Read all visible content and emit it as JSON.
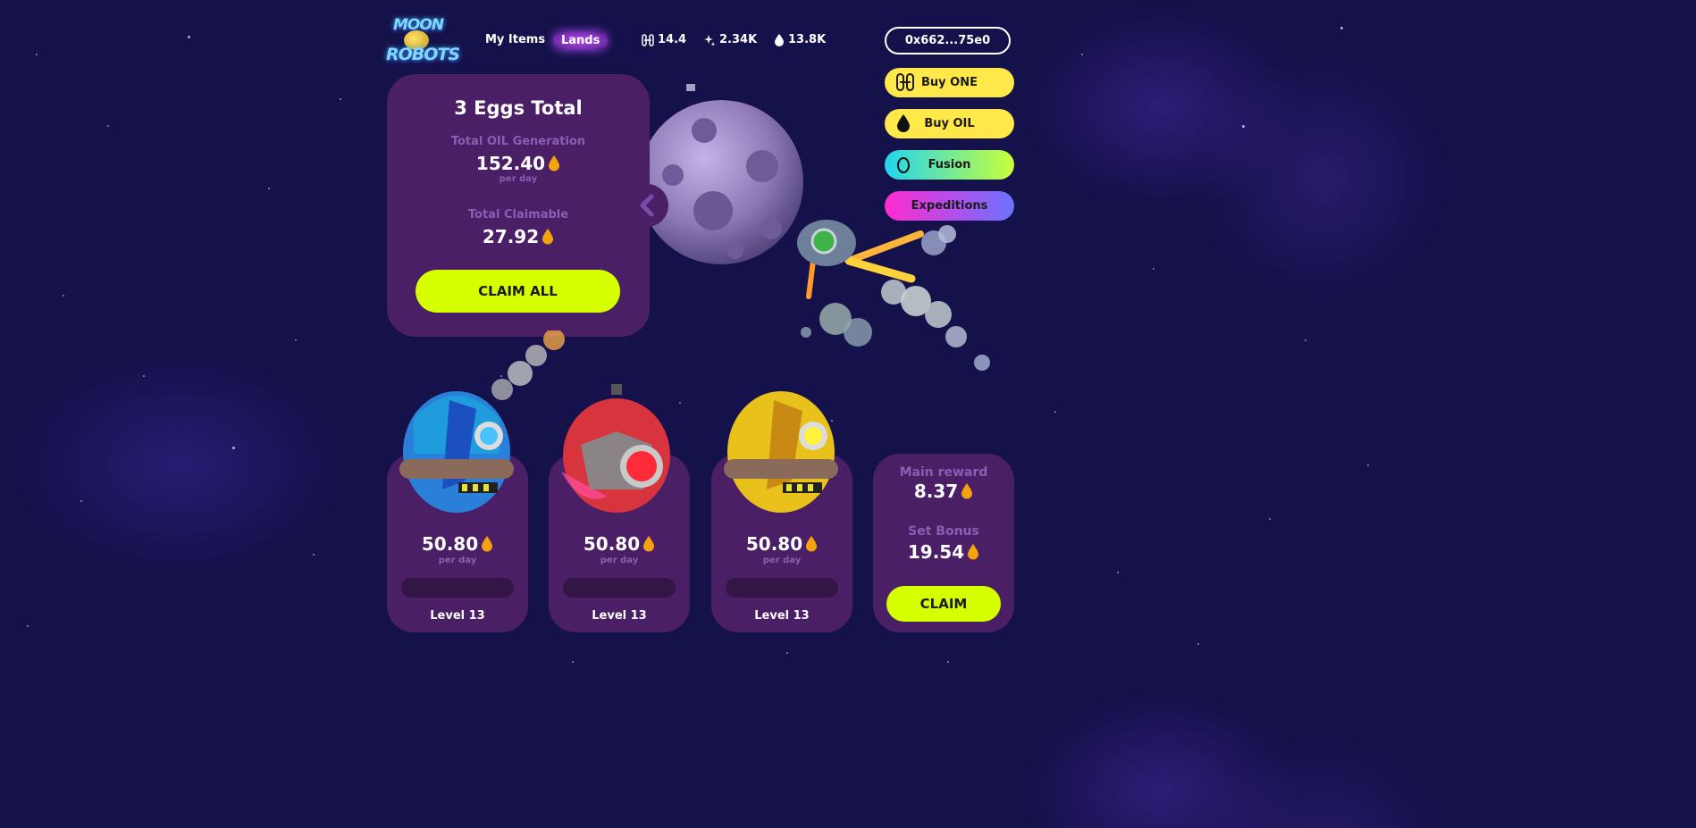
{
  "logo": {
    "line1": "MOON",
    "line2": "ROBOTS"
  },
  "nav": {
    "my_items": "My Items",
    "lands": "Lands"
  },
  "stats": [
    {
      "icon": "one-token-icon",
      "value": "14.4"
    },
    {
      "icon": "sparkle-icon",
      "value": "2.34K"
    },
    {
      "icon": "oil-drop-icon",
      "value": "13.8K"
    }
  ],
  "wallet": "0x662...75e0",
  "actions": {
    "buy_one": "Buy ONE",
    "buy_oil": "Buy OIL",
    "fusion": "Fusion",
    "expeditions": "Expeditions"
  },
  "summary": {
    "title": "3 Eggs Total",
    "oil_generation_label": "Total OIL Generation",
    "oil_generation_value": "152.40",
    "oil_generation_unit": "per day",
    "claimable_label": "Total Claimable",
    "claimable_value": "27.92",
    "claim_all": "CLAIM ALL"
  },
  "eggs": [
    {
      "color": "blue",
      "value": "50.80",
      "unit": "per day",
      "level": "Level 13"
    },
    {
      "color": "red",
      "value": "50.80",
      "unit": "per day",
      "level": "Level 13"
    },
    {
      "color": "yellow",
      "value": "50.80",
      "unit": "per day",
      "level": "Level 13"
    }
  ],
  "reward": {
    "main_label": "Main reward",
    "main_value": "8.37",
    "set_label": "Set Bonus",
    "set_value": "19.54",
    "claim": "CLAIM"
  },
  "colors": {
    "background": "#15114a",
    "card": "#4a1f66",
    "label": "#8d5db3",
    "accent_green": "#d6ff00",
    "accent_yellow": "#ffe84a",
    "fusion_start": "#21d4f0",
    "fusion_end": "#c9ff3a",
    "expeditions_start": "#ff2bd0",
    "expeditions_end": "#6b72ff"
  }
}
